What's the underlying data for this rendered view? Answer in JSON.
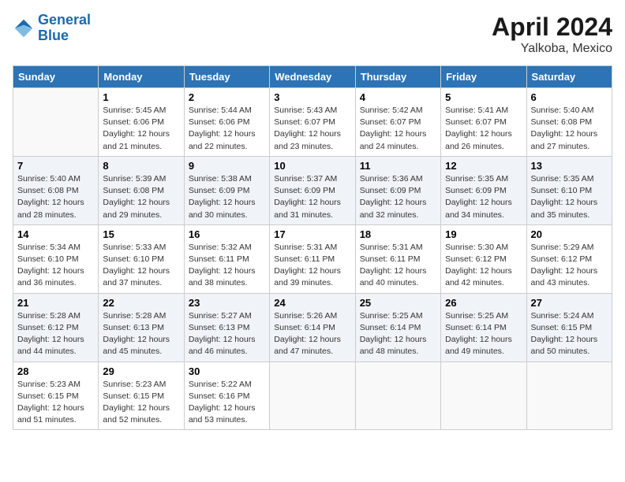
{
  "header": {
    "logo_line1": "General",
    "logo_line2": "Blue",
    "month": "April 2024",
    "location": "Yalkoba, Mexico"
  },
  "days_of_week": [
    "Sunday",
    "Monday",
    "Tuesday",
    "Wednesday",
    "Thursday",
    "Friday",
    "Saturday"
  ],
  "weeks": [
    [
      {
        "day": "",
        "info": ""
      },
      {
        "day": "1",
        "info": "Sunrise: 5:45 AM\nSunset: 6:06 PM\nDaylight: 12 hours\nand 21 minutes."
      },
      {
        "day": "2",
        "info": "Sunrise: 5:44 AM\nSunset: 6:06 PM\nDaylight: 12 hours\nand 22 minutes."
      },
      {
        "day": "3",
        "info": "Sunrise: 5:43 AM\nSunset: 6:07 PM\nDaylight: 12 hours\nand 23 minutes."
      },
      {
        "day": "4",
        "info": "Sunrise: 5:42 AM\nSunset: 6:07 PM\nDaylight: 12 hours\nand 24 minutes."
      },
      {
        "day": "5",
        "info": "Sunrise: 5:41 AM\nSunset: 6:07 PM\nDaylight: 12 hours\nand 26 minutes."
      },
      {
        "day": "6",
        "info": "Sunrise: 5:40 AM\nSunset: 6:08 PM\nDaylight: 12 hours\nand 27 minutes."
      }
    ],
    [
      {
        "day": "7",
        "info": "Sunrise: 5:40 AM\nSunset: 6:08 PM\nDaylight: 12 hours\nand 28 minutes."
      },
      {
        "day": "8",
        "info": "Sunrise: 5:39 AM\nSunset: 6:08 PM\nDaylight: 12 hours\nand 29 minutes."
      },
      {
        "day": "9",
        "info": "Sunrise: 5:38 AM\nSunset: 6:09 PM\nDaylight: 12 hours\nand 30 minutes."
      },
      {
        "day": "10",
        "info": "Sunrise: 5:37 AM\nSunset: 6:09 PM\nDaylight: 12 hours\nand 31 minutes."
      },
      {
        "day": "11",
        "info": "Sunrise: 5:36 AM\nSunset: 6:09 PM\nDaylight: 12 hours\nand 32 minutes."
      },
      {
        "day": "12",
        "info": "Sunrise: 5:35 AM\nSunset: 6:09 PM\nDaylight: 12 hours\nand 34 minutes."
      },
      {
        "day": "13",
        "info": "Sunrise: 5:35 AM\nSunset: 6:10 PM\nDaylight: 12 hours\nand 35 minutes."
      }
    ],
    [
      {
        "day": "14",
        "info": "Sunrise: 5:34 AM\nSunset: 6:10 PM\nDaylight: 12 hours\nand 36 minutes."
      },
      {
        "day": "15",
        "info": "Sunrise: 5:33 AM\nSunset: 6:10 PM\nDaylight: 12 hours\nand 37 minutes."
      },
      {
        "day": "16",
        "info": "Sunrise: 5:32 AM\nSunset: 6:11 PM\nDaylight: 12 hours\nand 38 minutes."
      },
      {
        "day": "17",
        "info": "Sunrise: 5:31 AM\nSunset: 6:11 PM\nDaylight: 12 hours\nand 39 minutes."
      },
      {
        "day": "18",
        "info": "Sunrise: 5:31 AM\nSunset: 6:11 PM\nDaylight: 12 hours\nand 40 minutes."
      },
      {
        "day": "19",
        "info": "Sunrise: 5:30 AM\nSunset: 6:12 PM\nDaylight: 12 hours\nand 42 minutes."
      },
      {
        "day": "20",
        "info": "Sunrise: 5:29 AM\nSunset: 6:12 PM\nDaylight: 12 hours\nand 43 minutes."
      }
    ],
    [
      {
        "day": "21",
        "info": "Sunrise: 5:28 AM\nSunset: 6:12 PM\nDaylight: 12 hours\nand 44 minutes."
      },
      {
        "day": "22",
        "info": "Sunrise: 5:28 AM\nSunset: 6:13 PM\nDaylight: 12 hours\nand 45 minutes."
      },
      {
        "day": "23",
        "info": "Sunrise: 5:27 AM\nSunset: 6:13 PM\nDaylight: 12 hours\nand 46 minutes."
      },
      {
        "day": "24",
        "info": "Sunrise: 5:26 AM\nSunset: 6:14 PM\nDaylight: 12 hours\nand 47 minutes."
      },
      {
        "day": "25",
        "info": "Sunrise: 5:25 AM\nSunset: 6:14 PM\nDaylight: 12 hours\nand 48 minutes."
      },
      {
        "day": "26",
        "info": "Sunrise: 5:25 AM\nSunset: 6:14 PM\nDaylight: 12 hours\nand 49 minutes."
      },
      {
        "day": "27",
        "info": "Sunrise: 5:24 AM\nSunset: 6:15 PM\nDaylight: 12 hours\nand 50 minutes."
      }
    ],
    [
      {
        "day": "28",
        "info": "Sunrise: 5:23 AM\nSunset: 6:15 PM\nDaylight: 12 hours\nand 51 minutes."
      },
      {
        "day": "29",
        "info": "Sunrise: 5:23 AM\nSunset: 6:15 PM\nDaylight: 12 hours\nand 52 minutes."
      },
      {
        "day": "30",
        "info": "Sunrise: 5:22 AM\nSunset: 6:16 PM\nDaylight: 12 hours\nand 53 minutes."
      },
      {
        "day": "",
        "info": ""
      },
      {
        "day": "",
        "info": ""
      },
      {
        "day": "",
        "info": ""
      },
      {
        "day": "",
        "info": ""
      }
    ]
  ]
}
